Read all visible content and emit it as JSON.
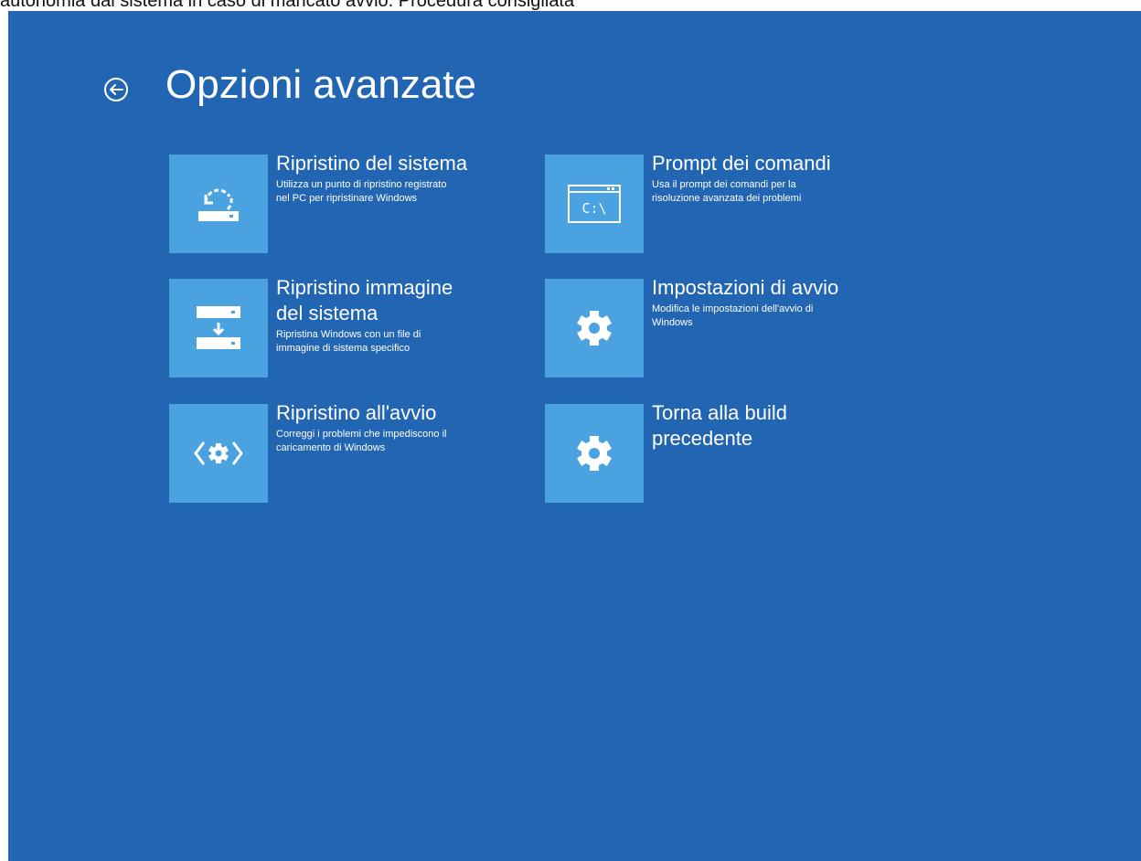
{
  "caption": "autonomia dal sistema in caso di mancato avvio. Procedura consigliata",
  "colors": {
    "background": "#2265b3",
    "tile": "#4aa3e0",
    "text": "#ffffff"
  },
  "header": {
    "back_icon": "back-arrow-circle-icon",
    "title": "Opzioni avanzate"
  },
  "options": [
    {
      "icon": "system-restore-icon",
      "title": "Ripristino del sistema",
      "description": "Utilizza un punto di ripristino registrato\nnel PC per ripristinare Windows"
    },
    {
      "icon": "command-prompt-icon",
      "icon_text": "C:\\",
      "title": "Prompt dei comandi",
      "description": "Usa il prompt dei comandi per la\nrisoluzione avanzata dei problemi"
    },
    {
      "icon": "system-image-recovery-icon",
      "title": "Ripristino immagine\ndel sistema",
      "description": "Ripristina Windows con un file di\nimmagine di sistema specifico"
    },
    {
      "icon": "gear-icon",
      "title": "Impostazioni di avvio",
      "description": "Modifica le impostazioni dell'avvio di\nWindows"
    },
    {
      "icon": "startup-repair-icon",
      "title": "Ripristino all'avvio",
      "description": "Correggi i problemi che impediscono il\ncaricamento di Windows"
    },
    {
      "icon": "gear-icon",
      "title": "Torna alla build\nprecedente",
      "description": ""
    }
  ]
}
